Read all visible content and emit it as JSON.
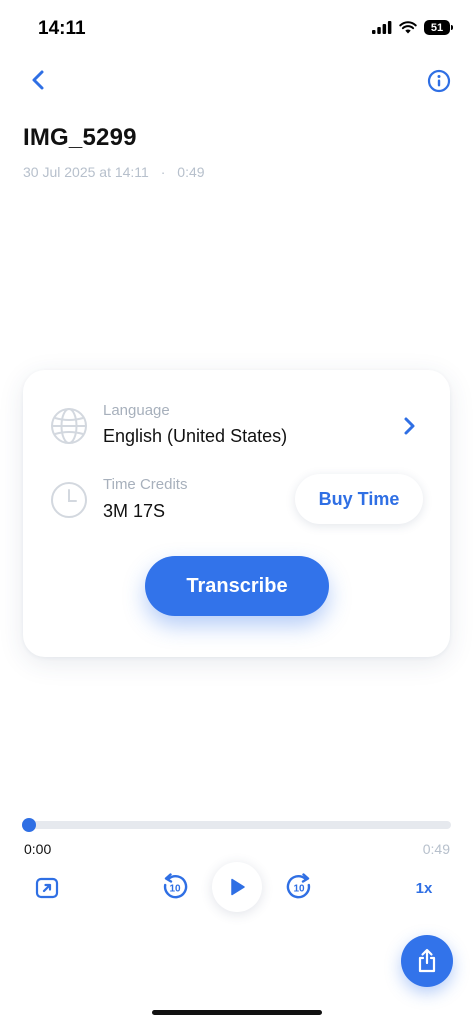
{
  "status_bar": {
    "time": "14:11",
    "battery": "51"
  },
  "recording": {
    "title": "IMG_5299",
    "date": "30 Jul 2025 at 14:11",
    "separator": "·",
    "duration": "0:49"
  },
  "settings": {
    "language_label": "Language",
    "language_value": "English (United States)",
    "credits_label": "Time Credits",
    "credits_value": "3M 17S",
    "buy_time_label": "Buy Time",
    "transcribe_label": "Transcribe"
  },
  "player": {
    "current_time": "0:00",
    "total_time": "0:49",
    "progress": 0.0,
    "speed_label": "1x",
    "skip_label": "10"
  },
  "colors": {
    "accent": "#3273ea",
    "muted_text": "#b7c0cc"
  },
  "icons": {
    "back": "chevron-left-icon",
    "info": "info-icon",
    "language": "globe-icon",
    "credits": "clock-icon",
    "language_chevron": "chevron-right-icon",
    "expand": "expand-icon",
    "rewind": "rewind-10-icon",
    "play": "play-icon",
    "forward": "forward-10-icon",
    "share": "share-icon"
  }
}
